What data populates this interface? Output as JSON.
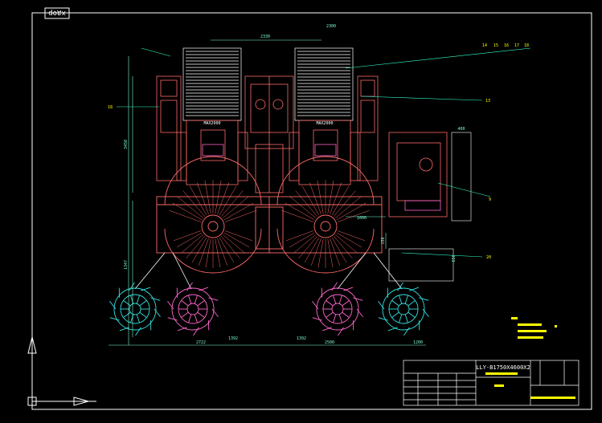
{
  "sheet_label": "xдоp",
  "title_block": {
    "drawing_no": "LLY-B1750X4600X2",
    "name_line": "",
    "sheet_word": ""
  },
  "dimensions": {
    "d2330": "2330",
    "d2300": "2300",
    "d3450": "3450",
    "d1600": "1600",
    "d1347": "1347",
    "d2722": "2722",
    "d1392a": "1392",
    "d1392b": "1392",
    "d2500": "2500",
    "d1200": "1200",
    "d400": "400",
    "d150": "150",
    "d650": "650"
  },
  "balloons": {
    "b14": "14",
    "b15": "15",
    "b16": "16",
    "b17": "17",
    "b18": "18",
    "b13": "13",
    "b18L": "18",
    "b9": "9",
    "b20": "20"
  },
  "side_label": "MAX2000",
  "colors": {
    "frame": "#ffffff",
    "machine": "#ff6a6a",
    "wheel_cyan": "#33e0e0",
    "wheel_pink": "#ff66cc",
    "dim": "#7fffd4",
    "note": "#ffff00",
    "leader": "#33ffcc"
  }
}
